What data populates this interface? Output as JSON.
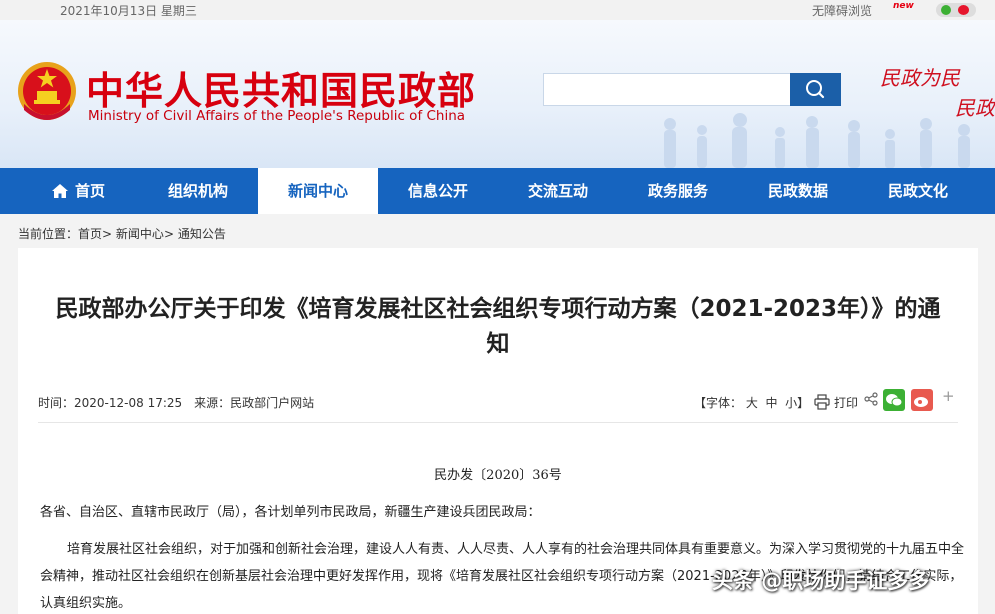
{
  "topbar": {
    "date": "2021年10月13日 星期三",
    "accessibility": "无障碍浏览",
    "new_badge": "new"
  },
  "header": {
    "title": "中华人民共和国民政部",
    "subtitle": "Ministry of Civil Affairs of the People's Republic of China",
    "search": {
      "placeholder": "",
      "value": ""
    },
    "slogan_line1": "民政为民",
    "slogan_line2": "民政"
  },
  "nav": {
    "items": [
      {
        "label": "首页",
        "icon": "home-icon"
      },
      {
        "label": "组织机构"
      },
      {
        "label": "新闻中心",
        "active": true
      },
      {
        "label": "信息公开"
      },
      {
        "label": "交流互动"
      },
      {
        "label": "政务服务"
      },
      {
        "label": "民政数据"
      },
      {
        "label": "民政文化"
      }
    ]
  },
  "breadcrumb": {
    "prefix": "当前位置：",
    "items": [
      "首页",
      "新闻中心",
      "通知公告"
    ],
    "separator": ">"
  },
  "article": {
    "title": "民政部办公厅关于印发《培育发展社区社会组织专项行动方案（2021-2023年）》的通知",
    "meta": {
      "time_label": "时间：",
      "time": "2020-12-08 17:25",
      "source_label": "来源：",
      "source": "民政部门户网站"
    },
    "tools": {
      "font_prefix": "【字体：",
      "font_large": "大",
      "font_medium": "中",
      "font_small": "小",
      "font_suffix": "】",
      "print": "打印",
      "plus": "+"
    },
    "doc_number": "民办发〔2020〕36号",
    "addressee": "各省、自治区、直辖市民政厅（局），各计划单列市民政局，新疆生产建设兵团民政局：",
    "body": "培育发展社区社会组织，对于加强和创新社会治理，建设人人有责、人人尽责、人人享有的社会治理共同体具有重要意义。为深入学习贯彻党的十九届五中全会精神，推动社区社会组织在创新基层社会治理中更好发挥作用，现将《培育发展社区社会组织专项行动方案（2021-2023年）》印发给你们，请结合工作实际，认真组织实施。"
  },
  "watermark": "头条 @职场助手证多多",
  "colors": {
    "brand_red": "#d7000f",
    "nav_blue": "#1664bf",
    "search_blue": "#1b5fa8"
  }
}
